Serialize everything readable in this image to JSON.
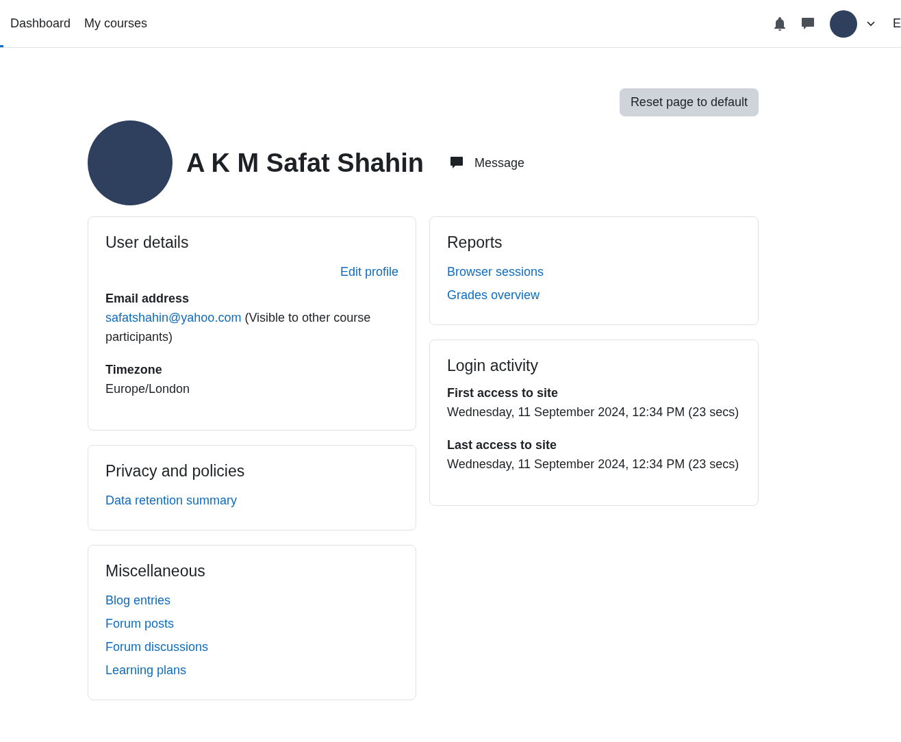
{
  "navbar": {
    "links": [
      {
        "label": "Dashboard"
      },
      {
        "label": "My courses"
      }
    ],
    "edge_text": "E"
  },
  "reset_button": "Reset page to default",
  "profile": {
    "name": "A K M Safat Shahin",
    "message_label": "Message"
  },
  "left_cards": [
    {
      "title": "User details",
      "edit_link": "Edit profile",
      "fields": [
        {
          "label": "Email address",
          "link": "safatshahin@yahoo.com",
          "text": " (Visible to other course participants)"
        },
        {
          "label": "Timezone",
          "text": "Europe/London"
        }
      ]
    },
    {
      "title": "Privacy and policies",
      "links": [
        "Data retention summary"
      ]
    },
    {
      "title": "Miscellaneous",
      "links": [
        "Blog entries",
        "Forum posts",
        "Forum discussions",
        "Learning plans"
      ]
    }
  ],
  "right_cards": [
    {
      "title": "Reports",
      "links": [
        "Browser sessions",
        "Grades overview"
      ]
    },
    {
      "title": "Login activity",
      "fields": [
        {
          "label": "First access to site",
          "text": "Wednesday, 11 September 2024, 12:34 PM  (23 secs)"
        },
        {
          "label": "Last access to site",
          "text": "Wednesday, 11 September 2024, 12:34 PM  (23 secs)"
        }
      ]
    }
  ]
}
